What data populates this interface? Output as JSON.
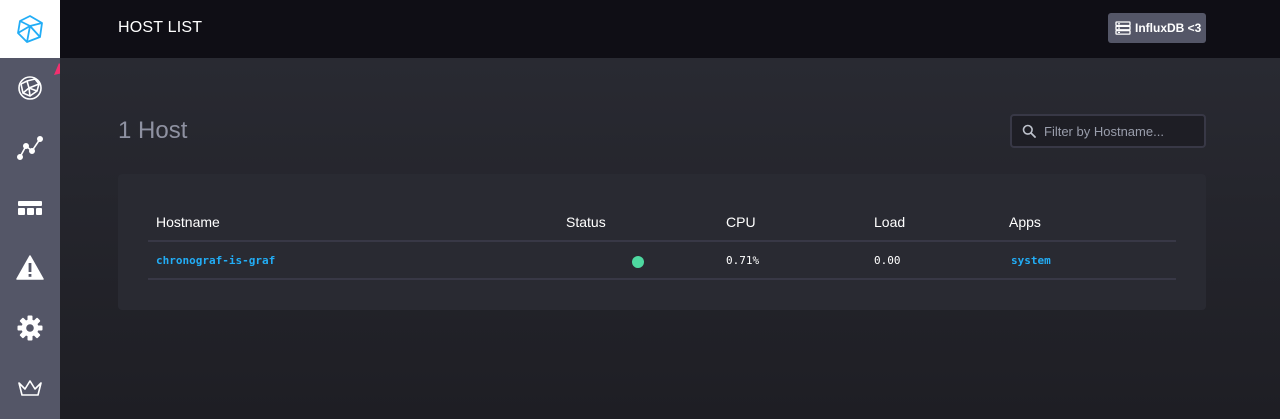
{
  "sidebar": {
    "logo_icon": "chronograf-logo-icon",
    "items": [
      {
        "name": "hosts",
        "icon": "graphs-globe-icon"
      },
      {
        "name": "data-explorer",
        "icon": "graph-line-icon"
      },
      {
        "name": "dashboards",
        "icon": "dashboards-grid-icon"
      },
      {
        "name": "alerts",
        "icon": "alert-triangle-icon"
      },
      {
        "name": "configuration",
        "icon": "cog-icon"
      },
      {
        "name": "admin",
        "icon": "crown-icon"
      }
    ]
  },
  "header": {
    "title": "HOST LIST",
    "source_label": "InfluxDB <3"
  },
  "main": {
    "host_count": "1 Host",
    "filter_placeholder": "Filter by Hostname...",
    "table": {
      "columns": [
        "Hostname",
        "Status",
        "CPU",
        "Load",
        "Apps"
      ],
      "rows": [
        {
          "hostname": "chronograf-is-graf",
          "status": "online",
          "cpu": "0.71%",
          "load": "0.00",
          "apps": "system"
        }
      ]
    }
  },
  "colors": {
    "accent_link": "#22adf6",
    "status_online": "#4ed8a0",
    "annotation_arrow": "#f1306f"
  }
}
